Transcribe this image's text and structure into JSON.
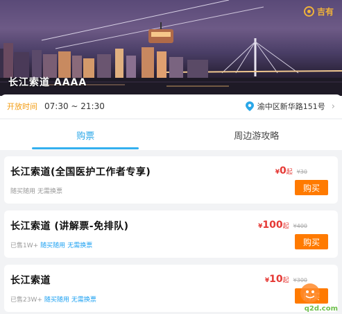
{
  "hero": {
    "title": "长江索道 AAAA",
    "brand_name": "吉有"
  },
  "info": {
    "hours_label": "开放时间",
    "hours_value": "07:30 ~ 21:30",
    "address": "渝中区新华路151号"
  },
  "tabs": [
    {
      "label": "购票",
      "active": true
    },
    {
      "label": "周边游攻略",
      "active": false
    }
  ],
  "tickets": [
    {
      "title": "长江索道(全国医护工作者专享)",
      "sold": "",
      "tags": [
        "随买随用",
        "无需换票"
      ],
      "tags_highlight": false,
      "price_currency": "¥",
      "price": "0",
      "price_unit": "起",
      "original_price": "¥30",
      "buy_label": "购买"
    },
    {
      "title": "长江索道 (讲解票-免排队)",
      "sold": "已售1W+",
      "tags": [
        "随买随用",
        "无需换票"
      ],
      "tags_highlight": true,
      "price_currency": "¥",
      "price": "100",
      "price_unit": "起",
      "original_price": "¥400",
      "buy_label": "购买"
    },
    {
      "title": "长江索道",
      "sold": "已售23W+",
      "tags": [
        "随买随用",
        "无需换票"
      ],
      "tags_highlight": true,
      "price_currency": "¥",
      "price": "10",
      "price_unit": "起",
      "original_price": "¥300",
      "buy_label": "购买"
    }
  ],
  "watermark": {
    "text": "q2d.com"
  },
  "colors": {
    "accent_blue": "#2aa7e8",
    "price_red": "#e53935",
    "buy_orange": "#ff7a00",
    "hours_orange": "#f39c12"
  }
}
